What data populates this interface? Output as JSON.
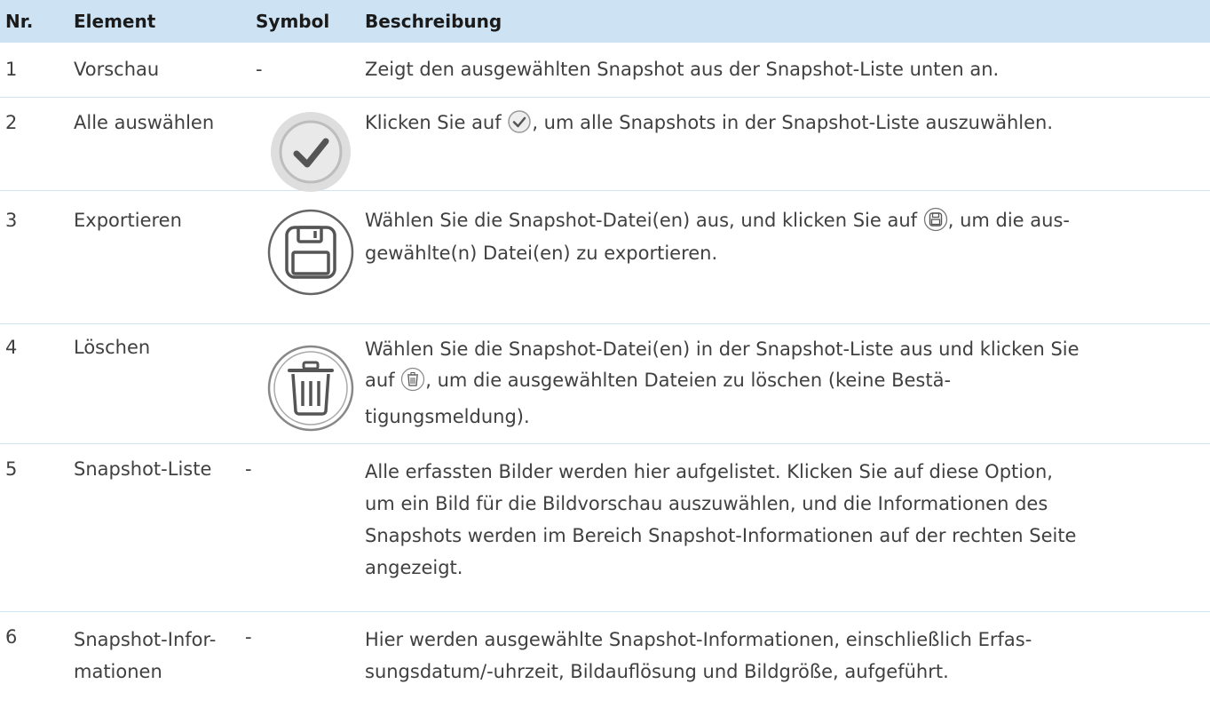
{
  "header": {
    "nr": "Nr.",
    "element": "Element",
    "symbol": "Symbol",
    "description": "Beschreibung"
  },
  "rows": [
    {
      "nr": "1",
      "element": "Vorschau",
      "symbol": "-",
      "desc_line1": "Zeigt den ausgewählten Snapshot aus der Snapshot-Liste unten an."
    },
    {
      "nr": "2",
      "element": "Alle auswählen",
      "icon": "checkmark-circle-icon",
      "desc_before": "Klicken Sie auf ",
      "desc_after": ", um alle Snapshots in der Snapshot-Liste auszuwählen."
    },
    {
      "nr": "3",
      "element": "Exportieren",
      "icon": "save-floppy-icon",
      "desc_before": "Wählen Sie die Snapshot-Datei(en) aus, und klicken Sie auf ",
      "desc_after": ", um die aus-",
      "desc_line2": "gewählte(n) Datei(en) zu exportieren."
    },
    {
      "nr": "4",
      "element": "Löschen",
      "icon": "trash-icon",
      "desc_line1": "Wählen Sie die Snapshot-Datei(en) in der Snapshot-Liste aus und klicken Sie",
      "desc_before": "auf ",
      "desc_after": ", um die ausgewählten Dateien zu löschen (keine Bestä-",
      "desc_line3": "tigungsmeldung)."
    },
    {
      "nr": "5",
      "element": "Snapshot-Liste",
      "symbol": "-",
      "desc_lines": [
        "Alle erfassten Bilder werden hier aufgelistet. Klicken Sie auf diese Option,",
        "um ein Bild für die Bildvorschau auszuwählen, und die Informationen des",
        "Snapshots werden im Bereich Snapshot-Informationen auf der rechten Seite",
        "angezeigt."
      ]
    },
    {
      "nr": "6",
      "element_line1": "Snapshot-Infor-",
      "element_line2": "mationen",
      "symbol": "-",
      "desc_lines": [
        "Hier werden ausgewählte Snapshot-Informationen, einschließlich Erfas-",
        "sungsdatum/-uhrzeit, Bildauflösung und Bildgröße, aufgeführt."
      ]
    }
  ]
}
